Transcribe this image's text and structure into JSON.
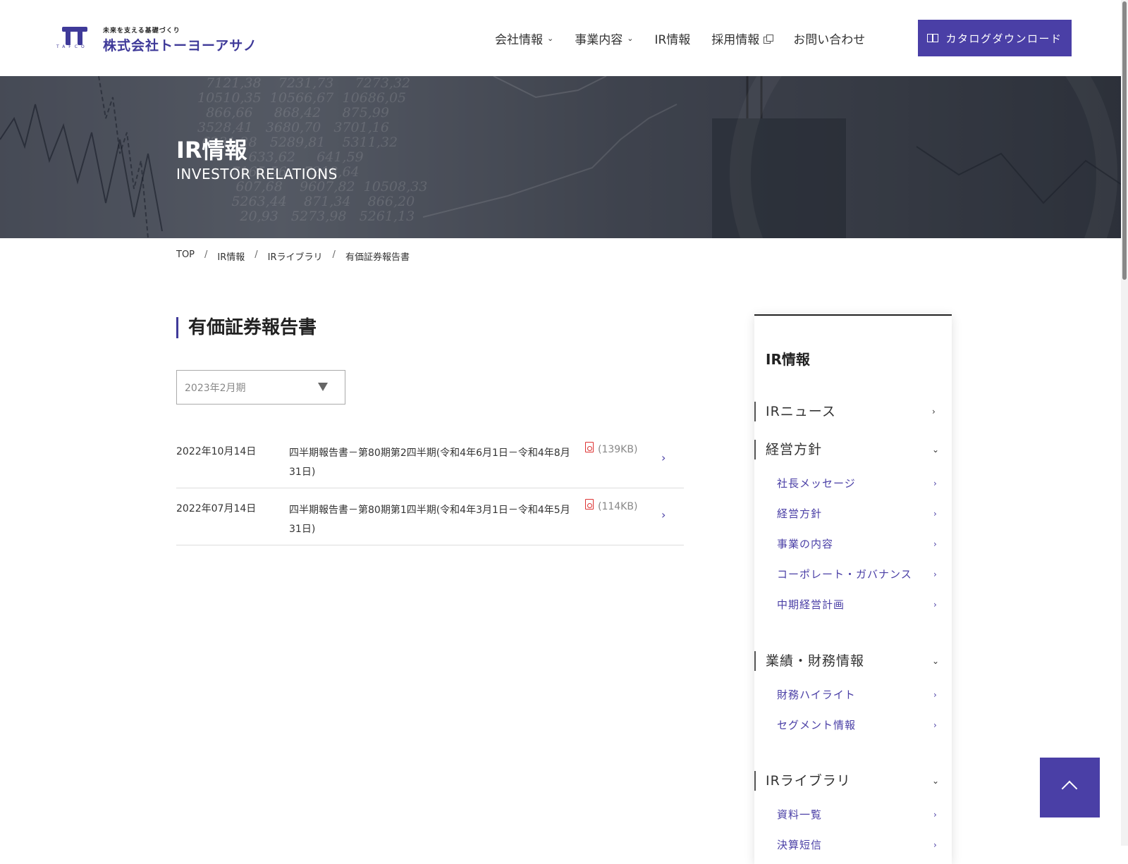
{
  "header": {
    "logo_tagline": "未来を支える基礎づくり",
    "logo_name": "株式会社トーヨーアサノ",
    "logo_mark_text": "TAFCO",
    "nav": [
      {
        "label": "会社情報",
        "icon": "chevron-down-icon"
      },
      {
        "label": "事業内容",
        "icon": "chevron-down-icon"
      },
      {
        "label": "IR情報"
      },
      {
        "label": "採用情報",
        "icon": "external-link-icon"
      },
      {
        "label": "お問い合わせ"
      }
    ],
    "catalog_button": "カタログダウンロード"
  },
  "hero": {
    "title": "IR情報",
    "subtitle": "INVESTOR RELATIONS"
  },
  "breadcrumb": [
    "TOP",
    "IR情報",
    "IRライブラリ",
    "有価証券報告書"
  ],
  "main": {
    "title": "有価証券報告書",
    "select_value": "2023年2月期",
    "documents": [
      {
        "date": "2022年10月14日",
        "title": "四半期報告書－第80期第2四半期(令和4年6月1日－令和4年8月31日)",
        "size": "(139KB)"
      },
      {
        "date": "2022年07月14日",
        "title": "四半期報告書－第80期第1四半期(令和4年3月1日－令和4年5月31日)",
        "size": "(114KB)"
      }
    ]
  },
  "sidebar": {
    "heading": "IR情報",
    "sections": [
      {
        "label": "IRニュース",
        "icon": "chevron-right-icon"
      },
      {
        "label": "経営方針",
        "icon": "chevron-down-icon",
        "children": [
          "社長メッセージ",
          "経営方針",
          "事業の内容",
          "コーポレート・ガバナンス",
          "中期経営計画"
        ]
      },
      {
        "label": "業績・財務情報",
        "icon": "chevron-down-icon",
        "children": [
          "財務ハイライト",
          "セグメント情報"
        ]
      },
      {
        "label": "IRライブラリ",
        "icon": "chevron-down-icon",
        "children": [
          "資料一覧",
          "決算短信"
        ]
      }
    ]
  }
}
